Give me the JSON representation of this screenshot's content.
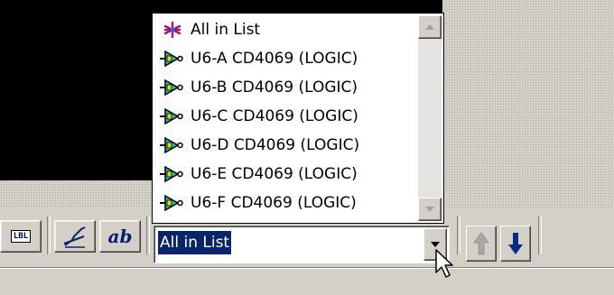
{
  "toolbar": {
    "label_button_text": "LBL",
    "text_style_button_text": "ab",
    "selector": {
      "selected_value": "All in List"
    }
  },
  "dropdown": {
    "items": [
      {
        "label": "All in List",
        "icon": "asterisk-icon"
      },
      {
        "label": "U6-A CD4069 (LOGIC)",
        "icon": "logic-gate-icon"
      },
      {
        "label": "U6-B CD4069 (LOGIC)",
        "icon": "logic-gate-icon"
      },
      {
        "label": "U6-C CD4069 (LOGIC)",
        "icon": "logic-gate-icon"
      },
      {
        "label": "U6-D CD4069 (LOGIC)",
        "icon": "logic-gate-icon"
      },
      {
        "label": "U6-E CD4069 (LOGIC)",
        "icon": "logic-gate-icon"
      },
      {
        "label": "U6-F CD4069 (LOGIC)",
        "icon": "logic-gate-icon"
      }
    ]
  },
  "nav": {
    "up_icon": "arrow-up-icon",
    "down_icon": "arrow-down-icon"
  },
  "colors": {
    "selection": "#0a246a",
    "gate_fill": "#1fbfb0",
    "asterisk": "#a4127a",
    "down_arrow": "#0a2a8a"
  }
}
